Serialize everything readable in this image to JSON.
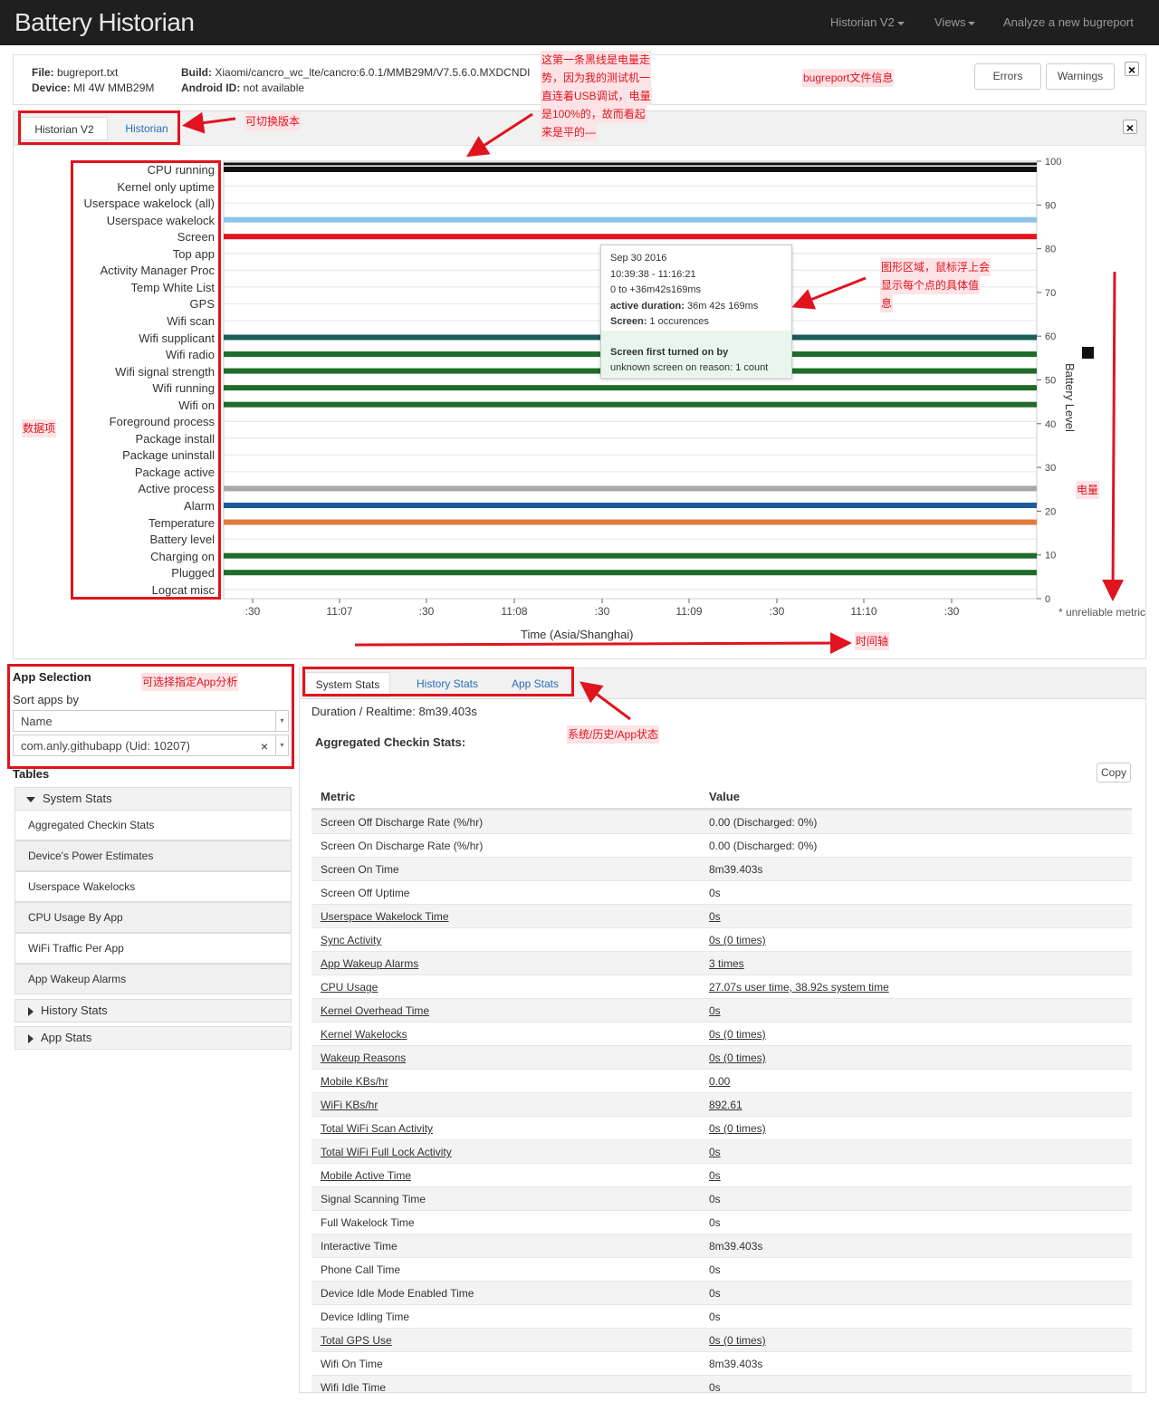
{
  "header": {
    "brand": "Battery Historian",
    "nav": [
      "Historian V2",
      "Views",
      "Analyze a new bugreport"
    ]
  },
  "file_info": {
    "file_label": "File:",
    "file": "bugreport.txt",
    "device_label": "Device:",
    "device": "MI 4W MMB29M",
    "build_label": "Build:",
    "build": "Xiaomi/cancro_wc_lte/cancro:6.0.1/MMB29M/V7.5.6.0.MXDCNDI",
    "android_label": "Android ID:",
    "android_id": "not available",
    "errors": "Errors",
    "warnings": "Warnings",
    "close": "×"
  },
  "timeline": {
    "tabs": [
      "Historian V2",
      "Historian"
    ],
    "close": "×",
    "rows": [
      "CPU running",
      "Kernel only uptime",
      "Userspace wakelock (all)",
      "Userspace wakelock",
      "Screen",
      "Top app",
      "Activity Manager Proc",
      "Temp White List",
      "GPS",
      "Wifi scan",
      "Wifi supplicant",
      "Wifi radio",
      "Wifi signal strength",
      "Wifi running",
      "Wifi on",
      "Foreground process",
      "Package install",
      "Package uninstall",
      "Package active",
      "Active process",
      "Alarm",
      "Temperature",
      "Battery level",
      "Charging on",
      "Plugged",
      "Logcat misc"
    ],
    "unreliable": "* unreliable metric",
    "x_ticks": [
      ":30",
      "11:07",
      ":30",
      "11:08",
      ":30",
      "11:09",
      ":30",
      "11:10",
      ":30"
    ],
    "y_ticks": [
      "100",
      "90",
      "80",
      "70",
      "60",
      "50",
      "40",
      "30",
      "20",
      "10",
      "0"
    ],
    "y_label": "Battery Level",
    "x_label": "Time (Asia/Shanghai)",
    "bars": [
      {
        "row": 0,
        "color": "#111111"
      },
      {
        "row": 3,
        "color": "#8ec4e8"
      },
      {
        "row": 4,
        "color": "#e3141f"
      },
      {
        "row": 10,
        "color": "#1b5e57"
      },
      {
        "row": 11,
        "color": "#1e6b2a"
      },
      {
        "row": 12,
        "color": "#1e6b2a"
      },
      {
        "row": 13,
        "color": "#1e6b2a"
      },
      {
        "row": 14,
        "color": "#1e6b2a"
      },
      {
        "row": 19,
        "color": "#a9a9a9"
      },
      {
        "row": 20,
        "color": "#1c5a9c"
      },
      {
        "row": 21,
        "color": "#e07b3c"
      },
      {
        "row": 23,
        "color": "#1e6b2a"
      },
      {
        "row": 24,
        "color": "#1e6b2a"
      }
    ],
    "tooltip": {
      "date": "Sep 30 2016",
      "time": "10:39:38 - 11:16:21",
      "range": "0 to +36m42s169ms",
      "duration_label": "active duration:",
      "duration": "36m 42s 169ms",
      "screen_label": "Screen:",
      "screen": "1 occurences",
      "first_on": "Screen first turned on by",
      "reason": "unknown screen on reason: 1 count"
    }
  },
  "annotations": {
    "black_line": [
      "这第一条黑线是电量走",
      "势，因为我的测试机一",
      "直连着USB调试，电量",
      "是100%的，故而看起",
      "来是平的—"
    ],
    "bugreport": "bugreport文件信息",
    "switch_version": "可切换版本",
    "chart_area": [
      "图形区域，鼠标浮上会",
      "显示每个点的具体值",
      "息"
    ],
    "data_items": "数据项",
    "battery": "电量",
    "time_axis": "时间轴",
    "app_select": "可选择指定App分析",
    "stats_tabs": "系统/历史/App状态"
  },
  "app_selection": {
    "title": "App Selection",
    "sort_label": "Sort apps by",
    "sort_value": "Name",
    "app_value": "com.anly.githubapp (Uid: 10207)",
    "clear": "×"
  },
  "tables": {
    "title": "Tables",
    "system_stats": "System Stats",
    "items": [
      "Aggregated Checkin Stats",
      "Device's Power Estimates",
      "Userspace Wakelocks",
      "CPU Usage By App",
      "WiFi Traffic Per App",
      "App Wakeup Alarms"
    ],
    "history_stats": "History Stats",
    "app_stats": "App Stats"
  },
  "stats": {
    "tabs": [
      "System Stats",
      "History Stats",
      "App Stats"
    ],
    "duration": "Duration / Realtime: 8m39.403s",
    "agg_title": "Aggregated Checkin Stats:",
    "copy": "Copy",
    "col_metric": "Metric",
    "col_value": "Value",
    "rows": [
      {
        "metric": "Screen Off Discharge Rate (%/hr)",
        "value": "0.00 (Discharged: 0%)",
        "link": false
      },
      {
        "metric": "Screen On Discharge Rate (%/hr)",
        "value": "0.00 (Discharged: 0%)",
        "link": false
      },
      {
        "metric": "Screen On Time",
        "value": "8m39.403s",
        "link": false
      },
      {
        "metric": "Screen Off Uptime",
        "value": "0s",
        "link": false
      },
      {
        "metric": "Userspace Wakelock Time",
        "value": "0s",
        "link": true
      },
      {
        "metric": "Sync Activity",
        "value": "0s (0 times)",
        "link": true
      },
      {
        "metric": "App Wakeup Alarms",
        "value": "3 times",
        "link": true
      },
      {
        "metric": "CPU Usage",
        "value": "27.07s user time, 38.92s system time",
        "link": true
      },
      {
        "metric": "Kernel Overhead Time",
        "value": "0s",
        "link": true
      },
      {
        "metric": "Kernel Wakelocks",
        "value": "0s (0 times)",
        "link": true
      },
      {
        "metric": "Wakeup Reasons",
        "value": "0s (0 times)",
        "link": true
      },
      {
        "metric": "Mobile KBs/hr",
        "value": "0.00",
        "link": true
      },
      {
        "metric": "WiFi KBs/hr",
        "value": "892.61",
        "link": true
      },
      {
        "metric": "Total WiFi Scan Activity",
        "value": "0s (0 times)",
        "link": true
      },
      {
        "metric": "Total WiFi Full Lock Activity",
        "value": "0s",
        "link": true
      },
      {
        "metric": "Mobile Active Time",
        "value": "0s",
        "link": true
      },
      {
        "metric": "Signal Scanning Time",
        "value": "0s",
        "link": false
      },
      {
        "metric": "Full Wakelock Time",
        "value": "0s",
        "link": false
      },
      {
        "metric": "Interactive Time",
        "value": "8m39.403s",
        "link": false
      },
      {
        "metric": "Phone Call Time",
        "value": "0s",
        "link": false
      },
      {
        "metric": "Device Idle Mode Enabled Time",
        "value": "0s",
        "link": false
      },
      {
        "metric": "Device Idling Time",
        "value": "0s",
        "link": false
      },
      {
        "metric": "Total GPS Use",
        "value": "0s (0 times)",
        "link": true
      },
      {
        "metric": "Wifi On Time",
        "value": "8m39.403s",
        "link": false
      },
      {
        "metric": "Wifi Idle Time",
        "value": "0s",
        "link": false
      }
    ]
  }
}
